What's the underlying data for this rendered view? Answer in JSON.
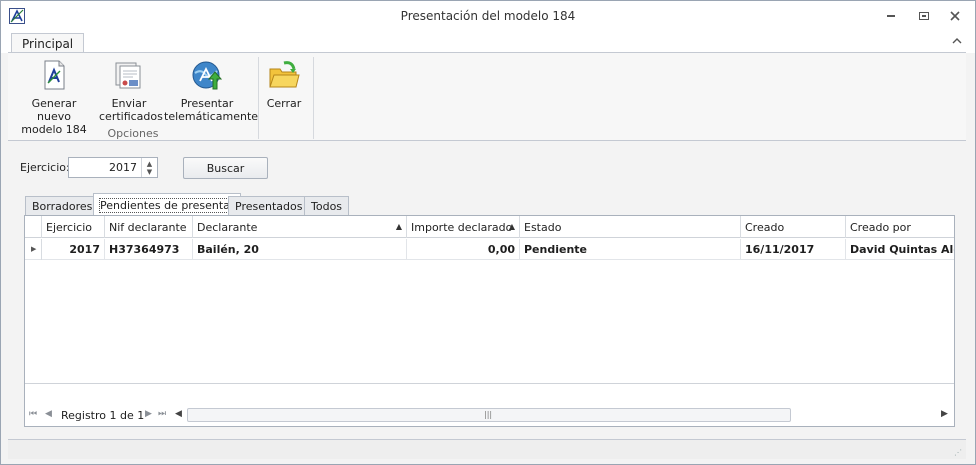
{
  "window": {
    "title": "Presentación del modelo 184",
    "icons": [
      "app-icon",
      "minimize-icon",
      "restore-icon",
      "close-icon"
    ]
  },
  "ribbon": {
    "tab": "Principal",
    "group_label": "Opciones",
    "buttons": [
      {
        "label_line1": "Generar nuevo",
        "label_line2": "modelo 184",
        "icon": "aeat-document-icon"
      },
      {
        "label_line1": "Enviar",
        "label_line2": "certificados",
        "icon": "certificates-icon"
      },
      {
        "label_line1": "Presentar",
        "label_line2": "telemáticamente",
        "icon": "globe-upload-icon"
      },
      {
        "label_line1": "Cerrar",
        "label_line2": "",
        "icon": "folder-exit-icon"
      }
    ]
  },
  "filter": {
    "label": "Ejercicio:",
    "year": "2017",
    "search_label": "Buscar"
  },
  "tabs": [
    "Borradores",
    "Pendientes de presentar",
    "Presentados",
    "Todos"
  ],
  "active_tab": "Pendientes de presentar",
  "grid": {
    "columns": [
      "Ejercicio",
      "Nif declarante",
      "Declarante",
      "Importe declarado",
      "Estado",
      "Creado",
      "Creado por"
    ],
    "rows": [
      {
        "ejercicio": "2017",
        "nif": "H37364973",
        "declarante": "Bailén, 20",
        "importe": "0,00",
        "estado": "Pendiente",
        "creado": "16/11/2017",
        "creado_por": "David Quintas Alca"
      }
    ],
    "navigator_text": "Registro 1 de 1"
  }
}
